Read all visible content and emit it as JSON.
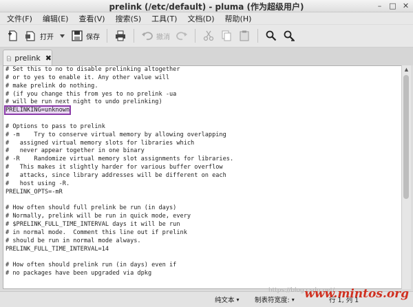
{
  "window": {
    "title": "prelink (/etc/default) - pluma (作为超级用户)"
  },
  "menu": [
    "文件(F)",
    "编辑(E)",
    "查看(V)",
    "搜索(S)",
    "工具(T)",
    "文档(D)",
    "帮助(H)"
  ],
  "toolbar": {
    "open_label": "打开",
    "save_label": "保存",
    "undo_label": "撤消"
  },
  "tab": {
    "label": "prelink"
  },
  "editor": {
    "lines_before": "# Set this to no to disable prelinking altogether\n# or to yes to enable it. Any other value will\n# make prelink do nothing.\n# (if you change this from yes to no prelink -ua\n# will be run next night to undo prelinking)\n",
    "highlighted": "PRELINKING=unknown",
    "lines_after": "\n\n# Options to pass to prelink\n# -m    Try to conserve virtual memory by allowing overlapping\n#   assigned virtual memory slots for libraries which\n#   never appear together in one binary\n# -R    Randomize virtual memory slot assignments for libraries.\n#   This makes it slightly harder for various buffer overflow\n#   attacks, since library addresses will be different on each\n#   host using -R.\nPRELINK_OPTS=-mR\n\n# How often should full prelink be run (in days)\n# Normally, prelink will be run in quick mode, every\n# $PRELINK_FULL_TIME_INTERVAL days it will be run\n# in normal mode.  Comment this line out if prelink\n# should be run in normal mode always.\nPRELINK_FULL_TIME_INTERVAL=14\n\n# How often should prelink run (in days) even if\n# no packages have been upgraded via dpkg"
  },
  "status": {
    "syntax": "纯文本",
    "tab_width": "制表符宽度:",
    "position": "行 1, 列 1"
  },
  "watermark": {
    "url": "https://blog.csdn.net/",
    "site": "www.mintos.org"
  }
}
